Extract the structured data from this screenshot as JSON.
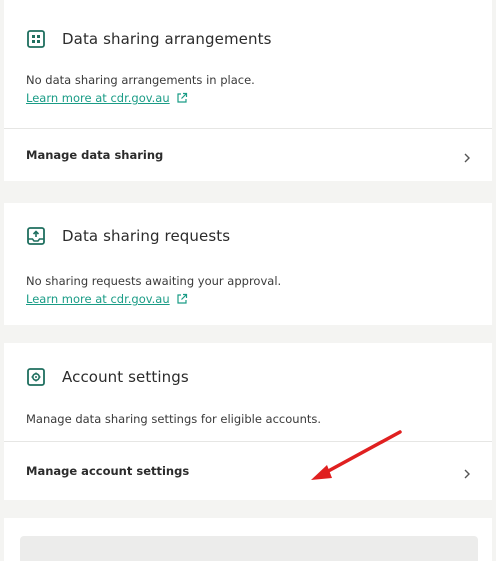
{
  "cards": {
    "arrangements": {
      "title": "Data sharing arrangements",
      "icon": "grid-icon",
      "body": "No data sharing arrangements in place.",
      "link": "Learn more at cdr.gov.au",
      "row_label": "Manage data sharing"
    },
    "requests": {
      "title": "Data sharing requests",
      "icon": "inbox-upload-icon",
      "body": "No sharing requests awaiting your approval.",
      "link": "Learn more at cdr.gov.au"
    },
    "account": {
      "title": "Account settings",
      "icon": "settings-gear-icon",
      "body": "Manage data sharing settings for eligible accounts.",
      "row_label": "Manage account settings"
    }
  },
  "colors": {
    "accent": "#1a9c86",
    "annotation_arrow": "#e02020",
    "background": "#f4f4f2",
    "card": "#ffffff"
  }
}
